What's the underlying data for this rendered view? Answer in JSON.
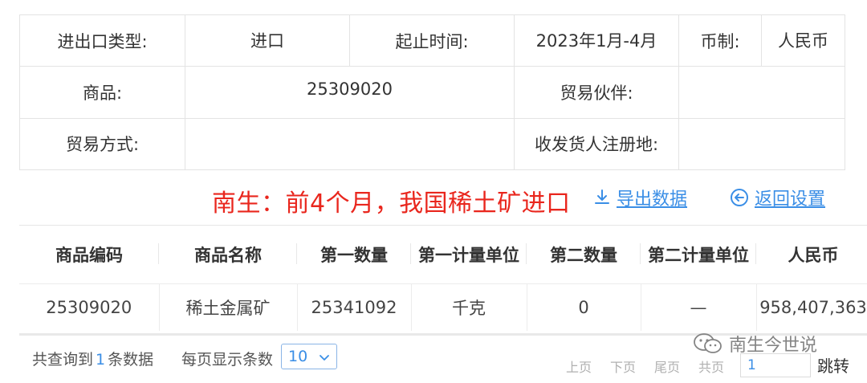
{
  "filters": {
    "trade_type_label": "进出口类型:",
    "trade_type_value": "进口",
    "period_label": "起止时间:",
    "period_value": "2023年1月-4月",
    "currency_label": "币制:",
    "currency_value": "人民币",
    "product_label": "商品:",
    "product_value": "25309020",
    "partner_label": "贸易伙伴:",
    "partner_value": "",
    "mode_label": "贸易方式:",
    "mode_value": "",
    "registration_label": "收发货人注册地:",
    "registration_value": ""
  },
  "toolbar": {
    "headline": "南生：前4个月，我国稀土矿进口",
    "export_label": "导出数据",
    "back_label": "返回设置",
    "colors": {
      "headline": "#e9261d",
      "link": "#3a8ee6"
    },
    "icons": {
      "export": "download-icon",
      "back": "back-arrow-icon"
    }
  },
  "results": {
    "columns": [
      "商品编码",
      "商品名称",
      "第一数量",
      "第一计量单位",
      "第二数量",
      "第二计量单位",
      "人民币"
    ],
    "rows": [
      [
        "25309020",
        "稀土金属矿",
        "25341092",
        "千克",
        "0",
        "—",
        "958,407,363"
      ]
    ]
  },
  "footer": {
    "count_prefix": "共查询到",
    "count_value": "1",
    "count_suffix": "条数据",
    "per_page_label": "每页显示条数",
    "per_page_value": "10",
    "prev_label": "上页",
    "next_label": "下页",
    "last_label": "尾页",
    "total_label": "共页",
    "jump_value": "1",
    "jump_label": "跳转"
  },
  "watermark": {
    "text": "南生今世说",
    "icon": "wechat-icon"
  }
}
